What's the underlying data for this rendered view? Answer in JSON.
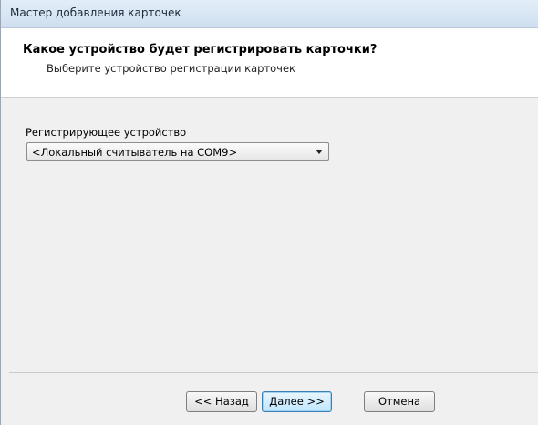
{
  "window": {
    "title": "Мастер добавления карточек"
  },
  "header": {
    "title": "Какое устройство будет регистрировать карточки?",
    "subtitle": "Выберите устройство регистрации карточек"
  },
  "form": {
    "device_label": "Регистрирующее устройство",
    "device_selected": "<Локальный считыватель на COM9>"
  },
  "buttons": {
    "back": "<< Назад",
    "next": "Далее >>",
    "cancel": "Отмена"
  }
}
